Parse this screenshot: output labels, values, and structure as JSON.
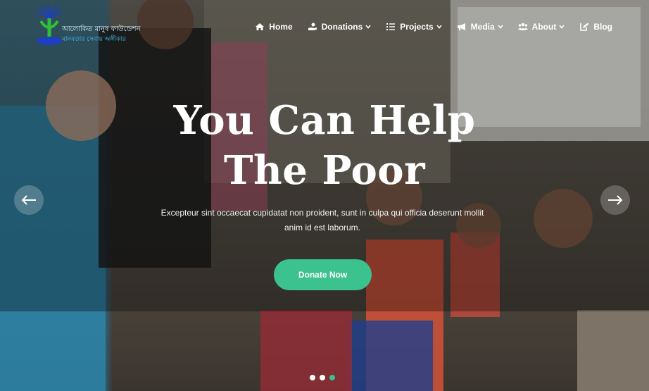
{
  "logo": {
    "line1": "আলোকিত মানুষ ফাউন্ডেশন",
    "line2": "মানবতার সেবায় অঙ্গীকার"
  },
  "nav": [
    {
      "label": "Home",
      "icon": "home-icon",
      "dropdown": false
    },
    {
      "label": "Donations",
      "icon": "donation-hand-icon",
      "dropdown": true
    },
    {
      "label": "Projects",
      "icon": "list-icon",
      "dropdown": true
    },
    {
      "label": "Media",
      "icon": "megaphone-icon",
      "dropdown": true
    },
    {
      "label": "About",
      "icon": "users-icon",
      "dropdown": true
    },
    {
      "label": "Blog",
      "icon": "blog-icon",
      "dropdown": false
    }
  ],
  "hero": {
    "headline_line1": "You Can Help",
    "headline_line2": "The Poor",
    "subtext_line1": "Excepteur sint occaecat cupidatat non proident, sunt in culpa qui officia deserunt mollit",
    "subtext_line2": "anim id est laborum.",
    "cta_label": "Donate Now"
  },
  "slider": {
    "prev_icon": "arrow-left-icon",
    "next_icon": "arrow-right-icon",
    "dot_count": 3,
    "active_dot": 3
  },
  "colors": {
    "accent": "#3cc28f",
    "text": "#ffffff"
  }
}
